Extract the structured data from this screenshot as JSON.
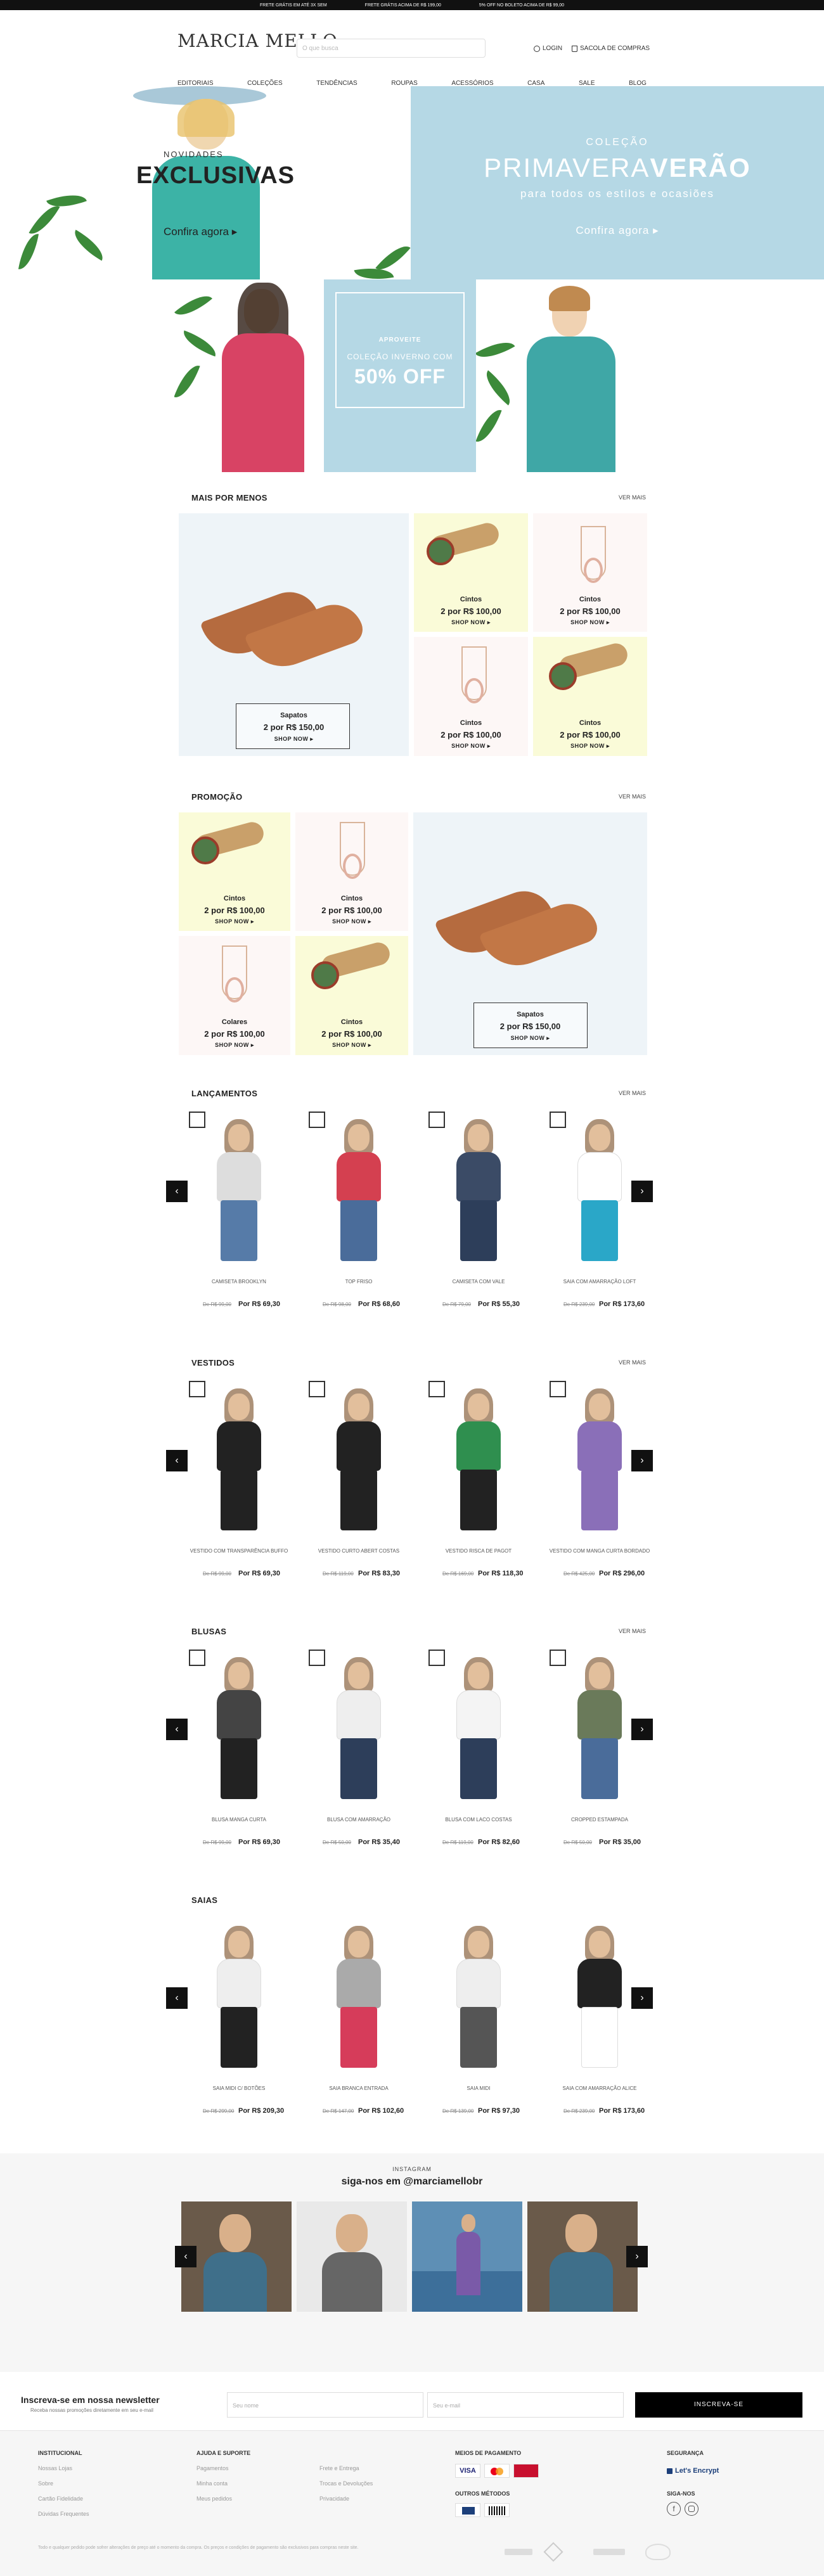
{
  "topbar": {
    "messages": [
      "FRETE GRÁTIS EM ATÉ 3X SEM",
      "FRETE GRÁTIS ACIMA DE R$ 199,00",
      "5% OFF NO BOLETO ACIMA DE R$ 99,00"
    ]
  },
  "header": {
    "logo": "MARCIA MELLO",
    "search_placeholder": "O que busca",
    "login": "LOGIN",
    "cart": "SACOLA DE COMPRAS",
    "nav": [
      "EDITORIAIS",
      "COLEÇÕES",
      "TENDÊNCIAS",
      "ROUPAS",
      "ACESSÓRIOS",
      "CASA",
      "SALE",
      "BLOG"
    ]
  },
  "hero_left": {
    "eyebrow": "NOVIDADES",
    "title": "EXCLUSIVAS",
    "cta": "Confira agora"
  },
  "hero_right": {
    "eyebrow": "COLEÇÃO",
    "title_light": "PRIMAVERA",
    "title_bold": "VERÃO",
    "subtitle": "para todos os estilos e ocasiões",
    "cta": "Confira agora"
  },
  "promo_banner": {
    "line1": "APROVEITE",
    "line2": "COLEÇÃO INVERNO COM",
    "big": "50% OFF"
  },
  "mais_por_menos": {
    "title": "MAIS POR MENOS",
    "see_more": "VER MAIS",
    "big": {
      "label": "Sapatos",
      "price": "2 por R$ 150,00",
      "shop": "SHOP NOW"
    },
    "small": [
      {
        "label": "Cintos",
        "price": "2 por R$ 100,00",
        "shop": "SHOP NOW"
      },
      {
        "label": "Cintos",
        "price": "2 por R$ 100,00",
        "shop": "SHOP NOW"
      },
      {
        "label": "Cintos",
        "price": "2 por R$ 100,00",
        "shop": "SHOP NOW"
      },
      {
        "label": "Cintos",
        "price": "2 por R$ 100,00",
        "shop": "SHOP NOW"
      }
    ]
  },
  "promocao": {
    "title": "PROMOÇÃO",
    "see_more": "VER MAIS",
    "big": {
      "label": "Sapatos",
      "price": "2 por R$ 150,00",
      "shop": "SHOP NOW"
    },
    "small": [
      {
        "label": "Cintos",
        "price": "2 por R$ 100,00",
        "shop": "SHOP NOW"
      },
      {
        "label": "Cintos",
        "price": "2 por R$ 100,00",
        "shop": "SHOP NOW"
      },
      {
        "label": "Colares",
        "price": "2 por R$ 100,00",
        "shop": "SHOP NOW"
      },
      {
        "label": "Cintos",
        "price": "2 por R$ 100,00",
        "shop": "SHOP NOW"
      }
    ]
  },
  "shelves": [
    {
      "title": "LANÇAMENTOS",
      "see_more": "VER MAIS",
      "products": [
        {
          "name": "CAMISETA BROOKLYN",
          "old": "De R$ 99,00",
          "new": "Por R$ 69,30",
          "top": "#ddd",
          "bottom": "#567ba8"
        },
        {
          "name": "TOP FRISO",
          "old": "De R$ 98,00",
          "new": "Por R$ 68,60",
          "top": "#d44050",
          "bottom": "#4a6c9a"
        },
        {
          "name": "CAMISETA COM VALE",
          "old": "De R$ 79,00",
          "new": "Por R$ 55,30",
          "top": "#3b4b66",
          "bottom": "#2d3e5a"
        },
        {
          "name": "SAIA COM AMARRAÇÃO LOFT",
          "old": "De R$ 239,00",
          "new": "Por R$ 173,60",
          "top": "#fff",
          "bottom": "#2aa7c8"
        }
      ]
    },
    {
      "title": "VESTIDOS",
      "see_more": "VER MAIS",
      "products": [
        {
          "name": "VESTIDO COM TRANSPARÊNCIA BUFFO",
          "old": "De R$ 99,00",
          "new": "Por R$ 69,30",
          "top": "#222",
          "bottom": "#222"
        },
        {
          "name": "VESTIDO CURTO ABERT COSTAS",
          "old": "De R$ 119,00",
          "new": "Por R$ 83,30",
          "top": "#222",
          "bottom": "#222"
        },
        {
          "name": "VESTIDO RISCA DE PAGOT",
          "old": "De R$ 169,00",
          "new": "Por R$ 118,30",
          "top": "#2f8f4f",
          "bottom": "#222"
        },
        {
          "name": "VESTIDO COM MANGA CURTA BORDADO",
          "old": "De R$ 425,00",
          "new": "Por R$ 296,00",
          "top": "#8a6fb8",
          "bottom": "#8a6fb8"
        }
      ]
    },
    {
      "title": "BLUSAS",
      "see_more": "VER MAIS",
      "products": [
        {
          "name": "BLUSA MANGA CURTA",
          "old": "De R$ 99,00",
          "new": "Por R$ 69,30",
          "top": "#444",
          "bottom": "#222"
        },
        {
          "name": "BLUSA COM AMARRAÇÃO",
          "old": "De R$ 50,00",
          "new": "Por R$ 35,40",
          "top": "#eee",
          "bottom": "#2d3e5a"
        },
        {
          "name": "BLUSA COM LACO COSTAS",
          "old": "De R$ 119,00",
          "new": "Por R$ 82,60",
          "top": "#f4f4f4",
          "bottom": "#2d3e5a"
        },
        {
          "name": "CROPPED ESTAMPADA",
          "old": "De R$ 50,00",
          "new": "Por R$ 35,00",
          "top": "#6a7a5a",
          "bottom": "#4a6c9a"
        }
      ]
    },
    {
      "title": "SAIAS",
      "see_more": "VER MAIS",
      "products": [
        {
          "name": "SAIA MIDI C/ BOTÕES",
          "old": "De R$ 299,00",
          "new": "Por R$ 209,30",
          "top": "#eee",
          "bottom": "#222"
        },
        {
          "name": "SAIA BRANCA ENTRADA",
          "old": "De R$ 147,00",
          "new": "Por R$ 102,60",
          "top": "#aaa",
          "bottom": "#d63c5a"
        },
        {
          "name": "SAIA MIDI",
          "old": "De R$ 139,00",
          "new": "Por R$ 97,30",
          "top": "#eee",
          "bottom": "#555"
        },
        {
          "name": "SAIA COM AMARRAÇÃO ALICE",
          "old": "De R$ 239,00",
          "new": "Por R$ 173,60",
          "top": "#222",
          "bottom": "#fff"
        }
      ]
    }
  ],
  "instagram": {
    "eyebrow": "INSTAGRAM",
    "title": "siga-nos em @marciamellobr"
  },
  "newsletter": {
    "title": "Inscreva-se em nossa newsletter",
    "subtitle": "Receba nossas promoções diretamente em seu e-mail",
    "name_placeholder": "Seu nome",
    "email_placeholder": "Seu e-mail",
    "button": "INSCREVA-SE"
  },
  "footer": {
    "col1_title": "INSTITUCIONAL",
    "col1": [
      "Nossas Lojas",
      "Sobre",
      "Cartão Fidelidade",
      "Dúvidas Frequentes"
    ],
    "col2_title": "AJUDA E SUPORTE",
    "col2": [
      "Pagamentos",
      "Minha conta",
      "Meus pedidos"
    ],
    "col2b": [
      "Frete e Entrega",
      "Trocas e Devoluções",
      "Privacidade"
    ],
    "col3_title": "MEIOS DE PAGAMENTO",
    "col3b_title": "OUTROS MÉTODOS",
    "col4_title": "SEGURANÇA",
    "security_badge": "Let's Encrypt",
    "col4b_title": "SIGA-NOS",
    "legal": "Todo e qualquer pedido pode sofrer alterações de preço até o momento da compra. Os preços e condições de pagamento são exclusivos para compras neste site."
  }
}
